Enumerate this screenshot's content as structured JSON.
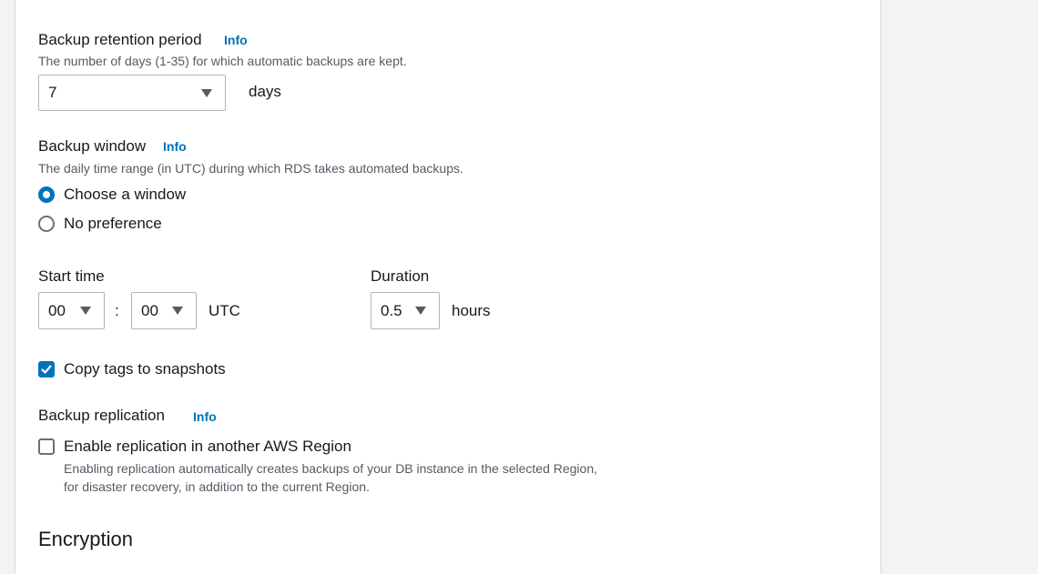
{
  "retention": {
    "label": "Backup retention period",
    "info": "Info",
    "description": "The number of days (1-35) for which automatic backups are kept.",
    "value": "7",
    "unit": "days"
  },
  "window": {
    "label": "Backup window",
    "info": "Info",
    "description": "The daily time range (in UTC) during which RDS takes automated backups.",
    "options": [
      {
        "label": "Choose a window",
        "checked": true
      },
      {
        "label": "No preference",
        "checked": false
      }
    ],
    "start_time": {
      "label": "Start time",
      "hour": "00",
      "separator": ":",
      "minute": "00",
      "zone": "UTC"
    },
    "duration": {
      "label": "Duration",
      "value": "0.5",
      "unit": "hours"
    }
  },
  "copy_tags": {
    "label": "Copy tags to snapshots",
    "checked": true
  },
  "replication": {
    "label": "Backup replication",
    "info": "Info",
    "checkbox_label": "Enable replication in another AWS Region",
    "checked": false,
    "description_line1": "Enabling replication automatically creates backups of your DB instance in the selected Region,",
    "description_line2": "for disaster recovery, in addition to the current Region."
  },
  "encryption": {
    "heading": "Encryption"
  },
  "colors": {
    "accent": "#0073bb",
    "text": "#16191f",
    "muted": "#545b64",
    "border": "#aab7b8",
    "background": "#f2f3f3"
  }
}
